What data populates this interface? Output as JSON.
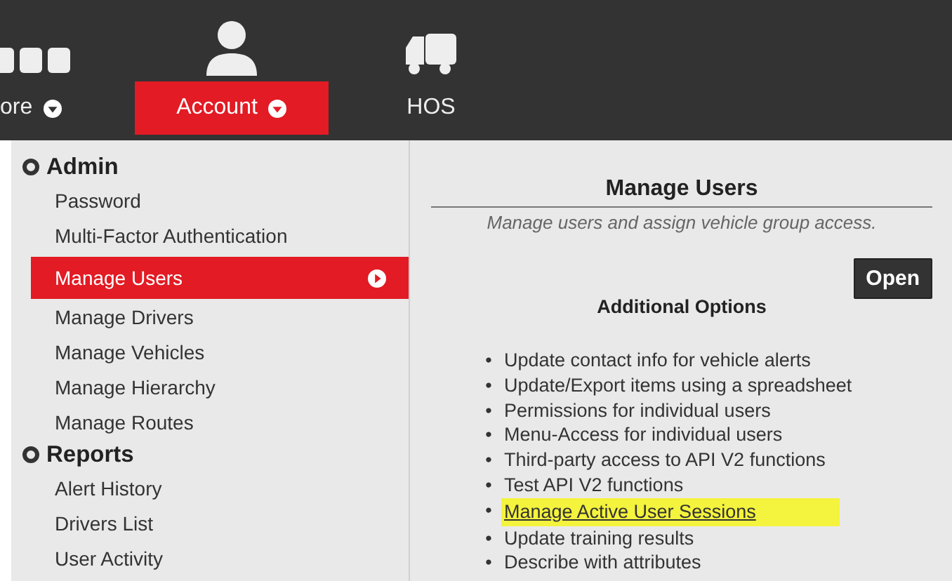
{
  "nav": {
    "items": [
      {
        "label": "ore",
        "selected": false,
        "caret": true
      },
      {
        "label": "Account",
        "selected": true,
        "caret": true
      },
      {
        "label": "HOS",
        "selected": false,
        "caret": false
      }
    ]
  },
  "menu": {
    "sections": [
      {
        "title": "Admin",
        "items": [
          {
            "label": "Password",
            "selected": false
          },
          {
            "label": "Multi-Factor Authentication",
            "selected": false
          },
          {
            "label": "Manage Users",
            "selected": true
          },
          {
            "label": "Manage Drivers",
            "selected": false
          },
          {
            "label": "Manage Vehicles",
            "selected": false
          },
          {
            "label": "Manage Hierarchy",
            "selected": false
          },
          {
            "label": "Manage Routes",
            "selected": false
          }
        ]
      },
      {
        "title": "Reports",
        "items": [
          {
            "label": "Alert History",
            "selected": false
          },
          {
            "label": "Drivers List",
            "selected": false
          },
          {
            "label": "User Activity",
            "selected": false
          }
        ]
      }
    ]
  },
  "panel": {
    "title": "Manage Users",
    "subtitle": "Manage users and assign vehicle group access.",
    "open_button": "Open",
    "options_heading": "Additional Options",
    "bullet": "•",
    "options": [
      {
        "label": "Update contact info for vehicle alerts",
        "kind": "text",
        "highlighted": false
      },
      {
        "label": "Update/Export items using a spreadsheet",
        "kind": "text",
        "highlighted": false
      },
      {
        "label": "Permissions for individual users",
        "kind": "text",
        "highlighted": false
      },
      {
        "label": "Menu-Access for individual users",
        "kind": "text",
        "highlighted": false
      },
      {
        "label": "Third-party access to API V2 functions",
        "kind": "text",
        "highlighted": false
      },
      {
        "label": "Test API V2 functions",
        "kind": "text",
        "highlighted": false
      },
      {
        "label": "Manage Active User Sessions",
        "kind": "link",
        "highlighted": true
      },
      {
        "label": "Update training results",
        "kind": "text",
        "highlighted": false
      },
      {
        "label": "Describe with attributes",
        "kind": "text",
        "highlighted": false
      }
    ]
  }
}
